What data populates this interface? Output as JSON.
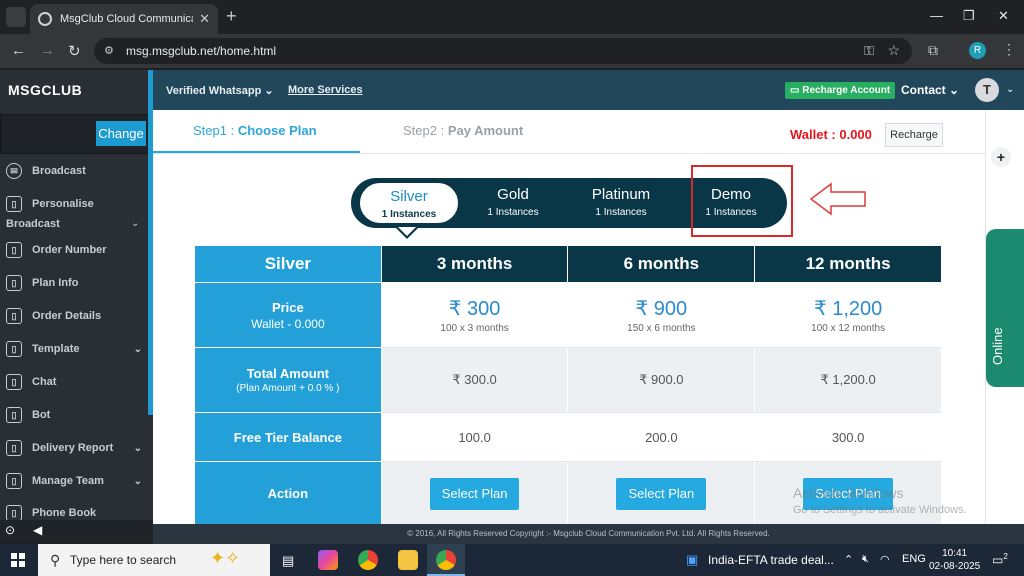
{
  "browser": {
    "tab_title": "MsgClub Cloud Communication",
    "tab_close": "✕",
    "new_tab": "+",
    "url": "msg.msgclub.net/home.html",
    "profile_initial": "R"
  },
  "sidebar": {
    "brand": "MSGCLUB",
    "change_label": "Change",
    "items": [
      {
        "label": "Broadcast"
      },
      {
        "label": "Personalise"
      },
      {
        "label": "Order Number"
      },
      {
        "label": "Plan Info"
      },
      {
        "label": "Order Details"
      },
      {
        "label": "Template"
      },
      {
        "label": "Chat"
      },
      {
        "label": "Bot"
      },
      {
        "label": "Delivery Report"
      },
      {
        "label": "Manage Team"
      },
      {
        "label": "Phone Book"
      }
    ],
    "personalise_sub": "Broadcast"
  },
  "topnav": {
    "verified_whatsapp": "Verified Whatsapp",
    "more_services": "More Services",
    "recharge_account": "Recharge Account",
    "contact": "Contact",
    "avatar_initial": "T"
  },
  "steps": {
    "step1_prefix": "Step1 : ",
    "step1_name": "Choose Plan",
    "step2_prefix": "Step2 : ",
    "step2_name": "Pay Amount",
    "wallet": "Wallet : 0.000",
    "recharge": "Recharge"
  },
  "plans": [
    {
      "name": "Silver",
      "instances": "1 Instances",
      "active": true
    },
    {
      "name": "Gold",
      "instances": "1 Instances"
    },
    {
      "name": "Platinum",
      "instances": "1 Instances"
    },
    {
      "name": "Demo",
      "instances": "1 Instances"
    }
  ],
  "table": {
    "plan_name": "Silver",
    "durations": [
      "3 months",
      "6 months",
      "12 months"
    ],
    "price_label": "Price",
    "price_sub": "Wallet - 0.000",
    "prices": [
      {
        "main": "₹ 300",
        "sub": "100 x 3 months"
      },
      {
        "main": "₹ 900",
        "sub": "150 x 6 months"
      },
      {
        "main": "₹ 1,200",
        "sub": "100 x 12 months"
      }
    ],
    "total_label": "Total Amount",
    "total_sub": "(Plan Amount + 0.0 % )",
    "totals": [
      "₹ 300.0",
      "₹ 900.0",
      "₹ 1,200.0"
    ],
    "free_tier_label": "Free Tier Balance",
    "free_tier": [
      "100.0",
      "200.0",
      "300.0"
    ],
    "action_label": "Action",
    "select_label": "Select Plan"
  },
  "online": "Online",
  "watermark": {
    "line1": "Activate Windows",
    "line2": "Go to Settings to activate Windows."
  },
  "footer": "© 2016, All Rights Reserved Copyright :- Msgclub Cloud Communication Pvt. Ltd. All Rights Reserved.",
  "taskbar": {
    "search_placeholder": "Type here to search",
    "news": "India-EFTA trade deal...",
    "lang": "ENG",
    "time": "10:41",
    "date": "02-08-2025",
    "notifications": "2"
  }
}
